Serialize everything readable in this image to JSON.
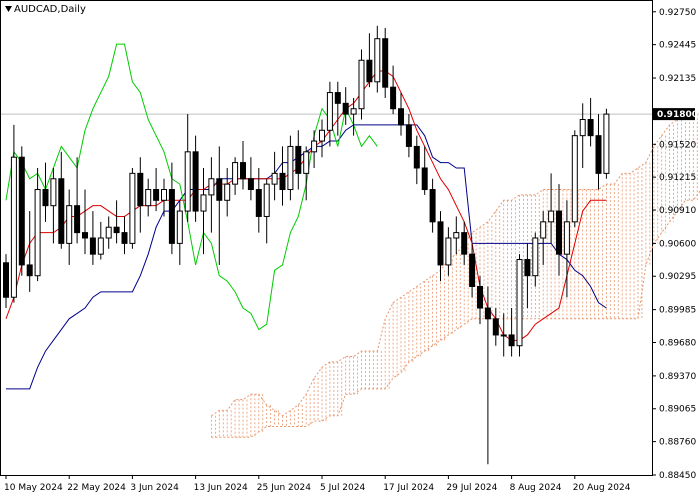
{
  "window": {
    "title": "AUDCAD,Daily",
    "menu_icon": "triangle-down-icon"
  },
  "chart_data": {
    "type": "candlestick",
    "symbol": "AUDCAD",
    "timeframe": "Daily",
    "title": "AUDCAD,Daily",
    "ylim": [
      0.8845,
      0.9285
    ],
    "y_ticks": [
      "0.92750",
      "0.92445",
      "0.92135",
      "0.91800",
      "0.91520",
      "0.91215",
      "0.90910",
      "0.90600",
      "0.90295",
      "0.89985",
      "0.89680",
      "0.89370",
      "0.89065",
      "0.88760",
      "0.88450"
    ],
    "x_ticks": [
      {
        "label": "10 May 2024",
        "index": 0
      },
      {
        "label": "22 May 2024",
        "index": 8
      },
      {
        "label": "3 Jun 2024",
        "index": 16
      },
      {
        "label": "13 Jun 2024",
        "index": 24
      },
      {
        "label": "25 Jun 2024",
        "index": 32
      },
      {
        "label": "5 Jul 2024",
        "index": 40
      },
      {
        "label": "17 Jul 2024",
        "index": 48
      },
      {
        "label": "29 Jul 2024",
        "index": 56
      },
      {
        "label": "8 Aug 2024",
        "index": 64
      },
      {
        "label": "20 Aug 2024",
        "index": 72
      }
    ],
    "current_price": "0.91800",
    "grid": false,
    "colors": {
      "bull": "#ffffff",
      "bear": "#000000",
      "wick": "#000000",
      "tenkan": "#dd0000",
      "kijun": "#00008b",
      "chikou": "#00cc00",
      "cloud": "#e8956a",
      "price_line": "#c0c0c0"
    },
    "ohlc": [
      [
        0.9042,
        0.905,
        0.9,
        0.901
      ],
      [
        0.901,
        0.917,
        0.9005,
        0.914
      ],
      [
        0.914,
        0.915,
        0.903,
        0.904
      ],
      [
        0.904,
        0.909,
        0.9015,
        0.903
      ],
      [
        0.903,
        0.913,
        0.9025,
        0.911
      ],
      [
        0.911,
        0.9135,
        0.908,
        0.9095
      ],
      [
        0.9095,
        0.913,
        0.906,
        0.912
      ],
      [
        0.912,
        0.9145,
        0.9055,
        0.906
      ],
      [
        0.906,
        0.911,
        0.904,
        0.9095
      ],
      [
        0.9095,
        0.914,
        0.906,
        0.907
      ],
      [
        0.907,
        0.911,
        0.905,
        0.9065
      ],
      [
        0.9065,
        0.909,
        0.904,
        0.905
      ],
      [
        0.905,
        0.908,
        0.9045,
        0.9065
      ],
      [
        0.9065,
        0.9085,
        0.9055,
        0.9075
      ],
      [
        0.9075,
        0.91,
        0.906,
        0.907
      ],
      [
        0.907,
        0.9085,
        0.905,
        0.906
      ],
      [
        0.906,
        0.913,
        0.9055,
        0.9125
      ],
      [
        0.9125,
        0.914,
        0.907,
        0.9095
      ],
      [
        0.9095,
        0.912,
        0.9085,
        0.911
      ],
      [
        0.911,
        0.913,
        0.909,
        0.91
      ],
      [
        0.91,
        0.912,
        0.9085,
        0.911
      ],
      [
        0.911,
        0.9135,
        0.905,
        0.906
      ],
      [
        0.906,
        0.91,
        0.904,
        0.909
      ],
      [
        0.909,
        0.918,
        0.908,
        0.9145
      ],
      [
        0.9145,
        0.916,
        0.908,
        0.909
      ],
      [
        0.909,
        0.913,
        0.905,
        0.9105
      ],
      [
        0.9105,
        0.914,
        0.907,
        0.912
      ],
      [
        0.912,
        0.915,
        0.904,
        0.91
      ],
      [
        0.91,
        0.913,
        0.9085,
        0.9115
      ],
      [
        0.9115,
        0.914,
        0.9105,
        0.9135
      ],
      [
        0.9135,
        0.9155,
        0.911,
        0.912
      ],
      [
        0.912,
        0.914,
        0.91,
        0.911
      ],
      [
        0.911,
        0.913,
        0.907,
        0.9085
      ],
      [
        0.9085,
        0.912,
        0.906,
        0.9115
      ],
      [
        0.9115,
        0.9145,
        0.91,
        0.9125
      ],
      [
        0.9125,
        0.915,
        0.9095,
        0.911
      ],
      [
        0.911,
        0.916,
        0.91,
        0.915
      ],
      [
        0.915,
        0.9165,
        0.911,
        0.9125
      ],
      [
        0.9125,
        0.915,
        0.91,
        0.9145
      ],
      [
        0.9145,
        0.9165,
        0.913,
        0.9155
      ],
      [
        0.9155,
        0.9175,
        0.914,
        0.9165
      ],
      [
        0.9165,
        0.921,
        0.915,
        0.92
      ],
      [
        0.92,
        0.921,
        0.916,
        0.919
      ],
      [
        0.919,
        0.9205,
        0.917,
        0.918
      ],
      [
        0.918,
        0.9195,
        0.916,
        0.9185
      ],
      [
        0.9185,
        0.924,
        0.9175,
        0.923
      ],
      [
        0.923,
        0.9255,
        0.9205,
        0.921
      ],
      [
        0.921,
        0.9262,
        0.92,
        0.925
      ],
      [
        0.925,
        0.926,
        0.9195,
        0.9205
      ],
      [
        0.9205,
        0.9225,
        0.918,
        0.9185
      ],
      [
        0.9185,
        0.92,
        0.916,
        0.917
      ],
      [
        0.917,
        0.918,
        0.914,
        0.915
      ],
      [
        0.915,
        0.916,
        0.9115,
        0.913
      ],
      [
        0.913,
        0.915,
        0.9105,
        0.911
      ],
      [
        0.911,
        0.912,
        0.907,
        0.908
      ],
      [
        0.908,
        0.909,
        0.9025,
        0.904
      ],
      [
        0.904,
        0.9075,
        0.903,
        0.9065
      ],
      [
        0.9065,
        0.9085,
        0.905,
        0.907
      ],
      [
        0.907,
        0.908,
        0.904,
        0.905
      ],
      [
        0.905,
        0.906,
        0.901,
        0.902
      ],
      [
        0.902,
        0.903,
        0.8985,
        0.9
      ],
      [
        0.9,
        0.902,
        0.8855,
        0.899
      ],
      [
        0.899,
        0.9,
        0.8965,
        0.8975
      ],
      [
        0.8975,
        0.8995,
        0.8955,
        0.8975
      ],
      [
        0.8975,
        0.9,
        0.8955,
        0.8965
      ],
      [
        0.8965,
        0.905,
        0.8955,
        0.9045
      ],
      [
        0.9045,
        0.906,
        0.9,
        0.903
      ],
      [
        0.903,
        0.907,
        0.902,
        0.9065
      ],
      [
        0.9065,
        0.909,
        0.904,
        0.908
      ],
      [
        0.908,
        0.9125,
        0.906,
        0.909
      ],
      [
        0.909,
        0.9115,
        0.903,
        0.905
      ],
      [
        0.905,
        0.91,
        0.901,
        0.908
      ],
      [
        0.908,
        0.9165,
        0.9075,
        0.916
      ],
      [
        0.916,
        0.919,
        0.913,
        0.9175
      ],
      [
        0.9175,
        0.9195,
        0.915,
        0.916
      ],
      [
        0.916,
        0.918,
        0.911,
        0.9125
      ],
      [
        0.9125,
        0.9185,
        0.912,
        0.918
      ]
    ],
    "tenkan": [
      0.899,
      0.901,
      0.904,
      0.906,
      0.907,
      0.907,
      0.907,
      0.9075,
      0.9085,
      0.9085,
      0.909,
      0.9095,
      0.9095,
      0.909,
      0.9085,
      0.9085,
      0.909,
      0.9095,
      0.9095,
      0.9095,
      0.91,
      0.91,
      0.91,
      0.91,
      0.911,
      0.911,
      0.9115,
      0.9115,
      0.9115,
      0.912,
      0.912,
      0.912,
      0.912,
      0.912,
      0.912,
      0.912,
      0.9125,
      0.913,
      0.914,
      0.915,
      0.9155,
      0.9165,
      0.9175,
      0.9185,
      0.919,
      0.92,
      0.921,
      0.922,
      0.922,
      0.9215,
      0.92,
      0.9185,
      0.9165,
      0.915,
      0.9135,
      0.912,
      0.911,
      0.9095,
      0.908,
      0.906,
      0.902,
      0.9,
      0.899,
      0.8975,
      0.897,
      0.897,
      0.8975,
      0.8985,
      0.899,
      0.8995,
      0.9,
      0.903,
      0.906,
      0.909,
      0.91,
      0.91,
      0.91
    ],
    "kijun": [
      0.8925,
      0.8925,
      0.8925,
      0.8925,
      0.8945,
      0.896,
      0.897,
      0.898,
      0.899,
      0.8995,
      0.9,
      0.901,
      0.9015,
      0.9015,
      0.9015,
      0.9015,
      0.9015,
      0.903,
      0.905,
      0.9075,
      0.909,
      0.909,
      0.91,
      0.911,
      0.911,
      0.911,
      0.911,
      0.912,
      0.912,
      0.912,
      0.912,
      0.912,
      0.912,
      0.912,
      0.9125,
      0.9135,
      0.9135,
      0.914,
      0.9145,
      0.915,
      0.915,
      0.9155,
      0.9155,
      0.9165,
      0.917,
      0.917,
      0.917,
      0.917,
      0.917,
      0.917,
      0.917,
      0.917,
      0.917,
      0.916,
      0.914,
      0.9135,
      0.9135,
      0.913,
      0.913,
      0.906,
      0.906,
      0.906,
      0.906,
      0.906,
      0.906,
      0.906,
      0.906,
      0.906,
      0.906,
      0.906,
      0.905,
      0.9045,
      0.9035,
      0.903,
      0.902,
      0.9005,
      0.9
    ],
    "chikou": [
      0.91,
      0.9145,
      0.9135,
      0.912,
      0.9125,
      0.911,
      0.913,
      0.915,
      0.914,
      0.913,
      0.9165,
      0.9185,
      0.92,
      0.9215,
      0.9245,
      0.9245,
      0.921,
      0.92,
      0.9175,
      0.916,
      0.9145,
      0.912,
      0.9115,
      0.908,
      0.904,
      0.907,
      0.906,
      0.903,
      0.9025,
      0.9015,
      0.9,
      0.8995,
      0.898,
      0.8985,
      0.9035,
      0.904,
      0.907,
      0.9085,
      0.9115,
      0.916,
      0.9185,
      0.9175,
      0.915,
      0.9185,
      0.917,
      0.915,
      0.916,
      0.915
    ],
    "cloud": {
      "shift": 26,
      "span_a": [
        0.89,
        0.8905,
        0.8905,
        0.8915,
        0.8915,
        0.892,
        0.892,
        0.891,
        0.8905,
        0.89,
        0.8905,
        0.891,
        0.892,
        0.8935,
        0.8945,
        0.895,
        0.895,
        0.8955,
        0.8955,
        0.896,
        0.896,
        0.896,
        0.899,
        0.9005,
        0.901,
        0.9015,
        0.902,
        0.9025,
        0.903,
        0.9035,
        0.9045,
        0.905,
        0.906,
        0.907,
        0.9075,
        0.908,
        0.909,
        0.91,
        0.91,
        0.9105,
        0.9105,
        0.9105,
        0.911,
        0.911,
        0.911,
        0.911,
        0.911,
        0.911,
        0.911,
        0.911,
        0.9115,
        0.9115,
        0.9125,
        0.9125,
        0.913,
        0.9135,
        0.915,
        0.916,
        0.917,
        0.9175,
        0.918,
        0.918,
        0.918,
        0.918,
        0.9175,
        0.917,
        0.916,
        0.916,
        0.916,
        0.9155,
        0.915,
        0.9145,
        0.914,
        0.914,
        0.9138,
        0.9138
      ],
      "span_b": [
        0.888,
        0.888,
        0.888,
        0.888,
        0.888,
        0.888,
        0.8885,
        0.889,
        0.889,
        0.889,
        0.889,
        0.889,
        0.889,
        0.8895,
        0.8895,
        0.89,
        0.89,
        0.892,
        0.892,
        0.8925,
        0.8925,
        0.8925,
        0.8925,
        0.8935,
        0.894,
        0.895,
        0.8955,
        0.896,
        0.8965,
        0.897,
        0.8975,
        0.898,
        0.8985,
        0.899,
        0.899,
        0.899,
        0.899,
        0.899,
        0.899,
        0.899,
        0.899,
        0.899,
        0.899,
        0.899,
        0.899,
        0.899,
        0.899,
        0.899,
        0.899,
        0.899,
        0.899,
        0.899,
        0.899,
        0.899,
        0.899,
        0.904,
        0.906,
        0.907,
        0.908,
        0.909,
        0.91,
        0.91,
        0.911,
        0.912,
        0.913,
        0.913,
        0.914,
        0.914,
        0.914,
        0.914,
        0.914,
        0.914,
        0.914,
        0.914,
        0.914,
        0.914
      ]
    }
  }
}
